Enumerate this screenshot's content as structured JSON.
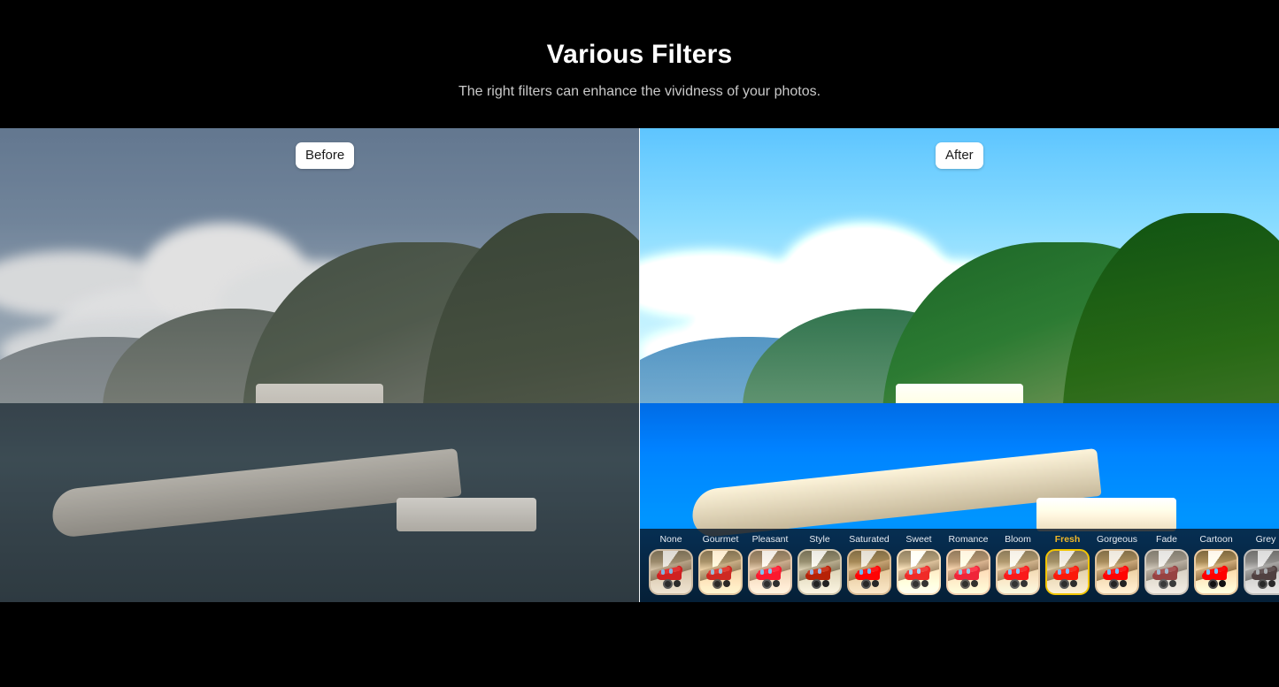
{
  "header": {
    "title": "Various Filters",
    "subtitle": "The right filters can enhance the vividness of your photos."
  },
  "compare": {
    "before_label": "Before",
    "after_label": "After"
  },
  "filters": {
    "selected": "Fresh",
    "accent_color": "#f0b828",
    "label_color": "#e7ecf2",
    "items": [
      {
        "label": "None"
      },
      {
        "label": "Gourmet"
      },
      {
        "label": "Pleasant"
      },
      {
        "label": "Style"
      },
      {
        "label": "Saturated"
      },
      {
        "label": "Sweet"
      },
      {
        "label": "Romance"
      },
      {
        "label": "Bloom"
      },
      {
        "label": "Fresh"
      },
      {
        "label": "Gorgeous"
      },
      {
        "label": "Fade"
      },
      {
        "label": "Cartoon"
      },
      {
        "label": "Grey"
      }
    ]
  }
}
